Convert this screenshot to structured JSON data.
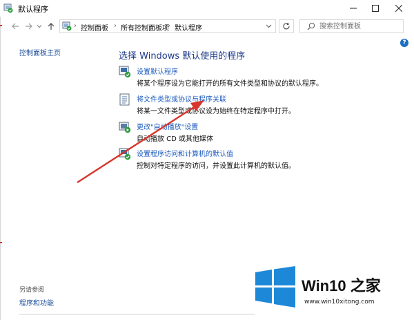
{
  "window": {
    "title": "默认程序",
    "controls": {
      "minimize": "—",
      "maximize": "☐",
      "close": "✕"
    }
  },
  "nav": {
    "back_icon": "arrow-left-icon",
    "forward_icon": "arrow-right-icon",
    "recent_icon": "chevron-down-icon",
    "up_icon": "arrow-up-icon",
    "breadcrumbs": [
      "控制面板",
      "所有控制面板项",
      "默认程序"
    ],
    "search_placeholder": "搜索控制面板"
  },
  "sidebar": {
    "home_link": "控制面板主页",
    "see_also_label": "另请参阅",
    "see_also_link": "程序和功能"
  },
  "main": {
    "heading": "选择 Windows 默认使用的程序",
    "items": [
      {
        "icon": "default-programs-icon",
        "link": "设置默认程序",
        "desc": "将某个程序设为它能打开的所有文件类型和协议的默认程序。"
      },
      {
        "icon": "file-association-icon",
        "link": "将文件类型或协议与程序关联",
        "desc": "将某一文件类型或协议设为始终在特定程序中打开。"
      },
      {
        "icon": "autoplay-icon",
        "link": "更改\"自动播放\"设置",
        "desc": "自动播放 CD 或其他媒体"
      },
      {
        "icon": "program-access-icon",
        "link": "设置程序访问和计算机的默认值",
        "desc": "控制对特定程序的访问，并设置此计算机的默认值。"
      }
    ]
  },
  "help": "?",
  "watermark": {
    "title": "Win10 之家",
    "url": "www.win10xitong.com",
    "color": "#1e88d8"
  },
  "colors": {
    "link": "#1c5bbf",
    "heading": "#1e3a8a",
    "annotation_arrow": "#d9362b"
  }
}
